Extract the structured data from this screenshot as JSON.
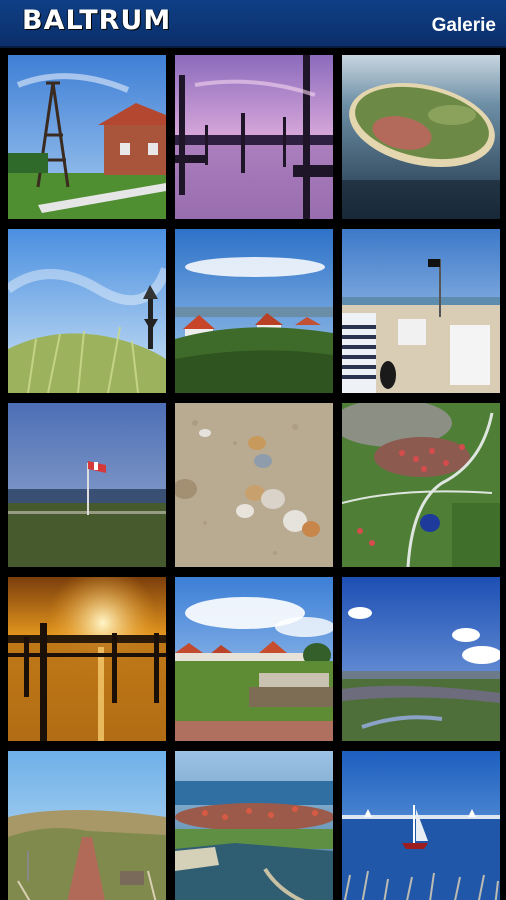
{
  "app": {
    "brand": "BALTRUM",
    "section": "Galerie"
  },
  "gallery": {
    "photos": [
      {
        "subject": "bell-tower-and-red-brick-house"
      },
      {
        "subject": "harbour-pilings-at-dusk"
      },
      {
        "subject": "aerial-view-of-island"
      },
      {
        "subject": "dune-grass-with-beacon"
      },
      {
        "subject": "village-roofs-behind-dunes"
      },
      {
        "subject": "beach-chairs-with-flag"
      },
      {
        "subject": "windsock-over-salt-marsh"
      },
      {
        "subject": "seashells-on-sand"
      },
      {
        "subject": "aerial-village-and-green-fields"
      },
      {
        "subject": "sunset-over-harbour"
      },
      {
        "subject": "houses-and-bench-on-meadow"
      },
      {
        "subject": "salt-marsh-under-blue-sky"
      },
      {
        "subject": "brick-path-through-dunes"
      },
      {
        "subject": "aerial-harbour-and-village"
      },
      {
        "subject": "sailboat-on-wadden-sea"
      }
    ]
  }
}
